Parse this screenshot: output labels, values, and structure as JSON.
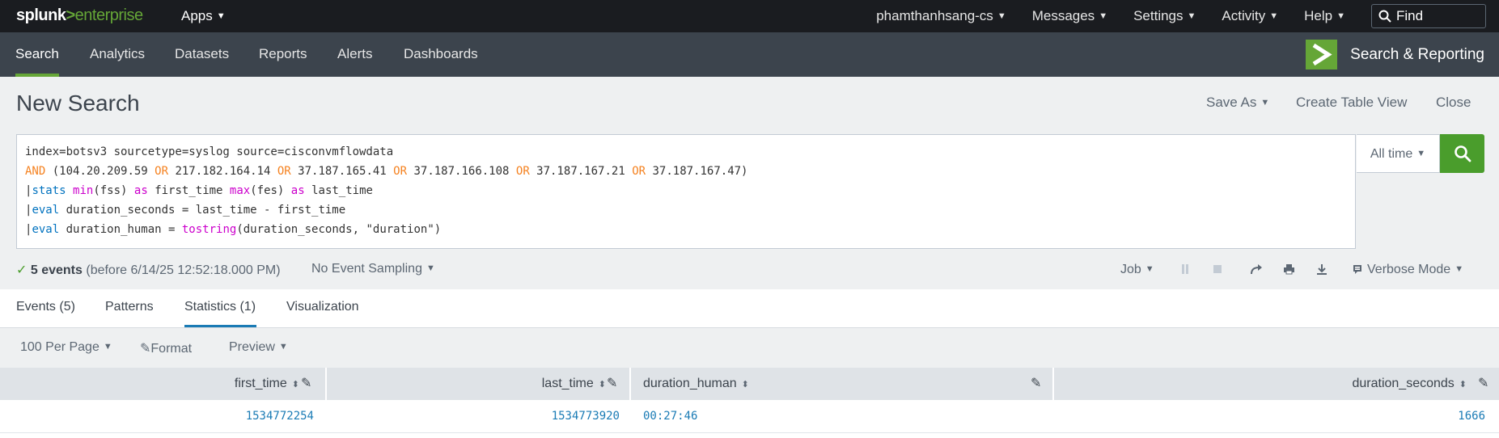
{
  "topbar": {
    "logo_splunk": "splunk",
    "logo_gt": ">",
    "logo_product": "enterprise",
    "apps": "Apps",
    "user": "phamthanhsang-cs",
    "messages": "Messages",
    "settings": "Settings",
    "activity": "Activity",
    "help": "Help",
    "find_placeholder": "Find"
  },
  "appbar": {
    "tabs": [
      "Search",
      "Analytics",
      "Datasets",
      "Reports",
      "Alerts",
      "Dashboards"
    ],
    "app_title": "Search & Reporting"
  },
  "header": {
    "title": "New Search",
    "save_as": "Save As",
    "create_table_view": "Create Table View",
    "close": "Close"
  },
  "query": {
    "l1": "index=botsv3 sourcetype=syslog source=cisconvmflowdata",
    "l2": [
      "AND",
      " (104.20.209.59 ",
      "OR",
      " 217.182.164.14 ",
      "OR",
      " 37.187.165.41 ",
      "OR",
      " 37.187.166.108 ",
      "OR",
      " 37.187.167.21 ",
      "OR",
      " 37.187.167.47)"
    ],
    "l3": [
      "|",
      "stats",
      " ",
      "min",
      "(fss) ",
      "as",
      " first_time ",
      "max",
      "(fes) ",
      "as",
      " last_time"
    ],
    "l4": [
      "|",
      "eval",
      " duration_seconds = last_time - first_time"
    ],
    "l5": [
      "|",
      "eval",
      " duration_human = ",
      "tostring",
      "(duration_seconds, \"duration\")"
    ]
  },
  "timepicker": "All time",
  "status": {
    "count": "5 events",
    "detail": "(before 6/14/25 12:52:18.000 PM)",
    "sampling": "No Event Sampling",
    "job": "Job",
    "mode": "Verbose Mode"
  },
  "result_tabs": [
    "Events (5)",
    "Patterns",
    "Statistics (1)",
    "Visualization"
  ],
  "toolbar": {
    "per_page": "100 Per Page",
    "format": "Format",
    "preview": "Preview"
  },
  "table": {
    "columns": [
      "first_time",
      "last_time",
      "duration_human",
      "duration_seconds"
    ],
    "rows": [
      [
        "1534772254",
        "1534773920",
        "00:27:46",
        "1666"
      ]
    ]
  },
  "colors": {
    "accent_green": "#65a637",
    "search_button": "#4a9d2c",
    "link_blue": "#1a7bb5",
    "keyword_orange": "#f58220",
    "command_blue": "#0072bf",
    "function_magenta": "#cc00cc"
  }
}
